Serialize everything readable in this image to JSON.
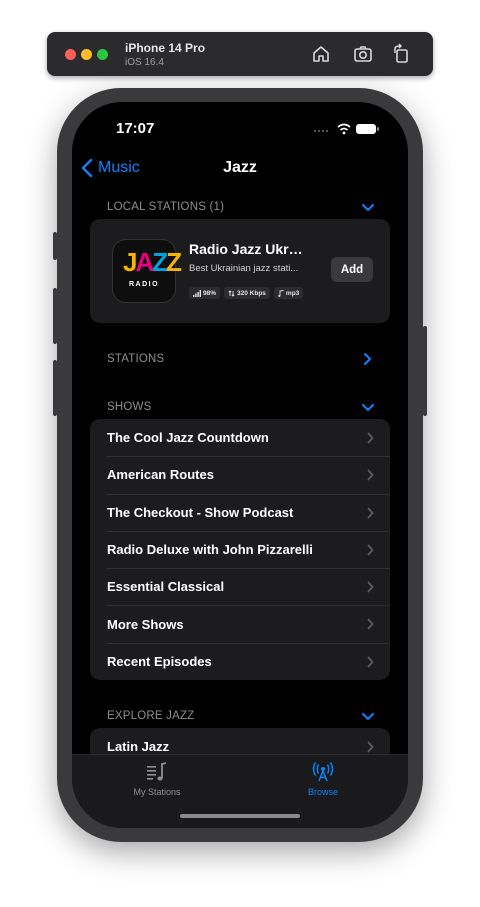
{
  "simulator": {
    "device_name": "iPhone 14 Pro",
    "os_version": "iOS 16.4",
    "buttons": [
      "home-icon",
      "screenshot-icon",
      "rotate-icon"
    ]
  },
  "status_bar": {
    "time": "17:07"
  },
  "nav": {
    "back_label": "Music",
    "title": "Jazz"
  },
  "local_stations": {
    "header": "LOCAL STATIONS (1)",
    "station": {
      "logo_text": "JAZZ",
      "logo_subtext": "RADIO",
      "name": "Radio Jazz Ukrai...",
      "description": "Best Ukrainian jazz stati...",
      "signal": "98%",
      "bitrate": "320 Kbps",
      "format": "mp3",
      "add_label": "Add"
    }
  },
  "stations": {
    "header": "STATIONS"
  },
  "shows": {
    "header": "SHOWS",
    "items": [
      "The Cool Jazz Countdown",
      "American Routes",
      "The Checkout - Show Podcast",
      "Radio Deluxe with John Pizzarelli",
      "Essential Classical",
      "More Shows",
      "Recent Episodes"
    ]
  },
  "explore": {
    "header": "EXPLORE JAZZ",
    "items": [
      "Latin Jazz"
    ]
  },
  "tabbar": {
    "tabs": [
      {
        "label": "My Stations",
        "icon": "music-list-icon",
        "active": false
      },
      {
        "label": "Browse",
        "icon": "antenna-icon",
        "active": true
      }
    ]
  },
  "colors": {
    "accent": "#0a84ff",
    "card": "#1c1c1e",
    "muted": "#8e8e93"
  }
}
